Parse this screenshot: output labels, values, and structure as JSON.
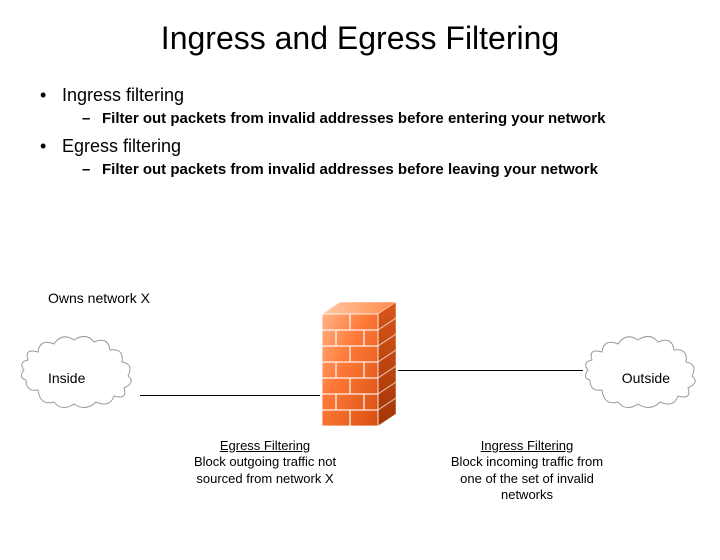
{
  "title": "Ingress and Egress Filtering",
  "bullets": {
    "b1a": "Ingress filtering",
    "b2a": "Filter out packets from invalid addresses before entering your network",
    "b1b": "Egress filtering",
    "b2b": "Filter out packets from invalid addresses before leaving your network"
  },
  "diagram": {
    "owns": "Owns network X",
    "inside": "Inside",
    "outside": "Outside",
    "egress": {
      "head": "Egress Filtering",
      "line1": "Block outgoing traffic not",
      "line2": "sourced from network X"
    },
    "ingress": {
      "head": "Ingress Filtering",
      "line1": "Block incoming traffic from",
      "line2": "one of the set of invalid",
      "line3": "networks"
    }
  },
  "colors": {
    "wall_light": "#ff955c",
    "wall_dark": "#c94a12"
  }
}
